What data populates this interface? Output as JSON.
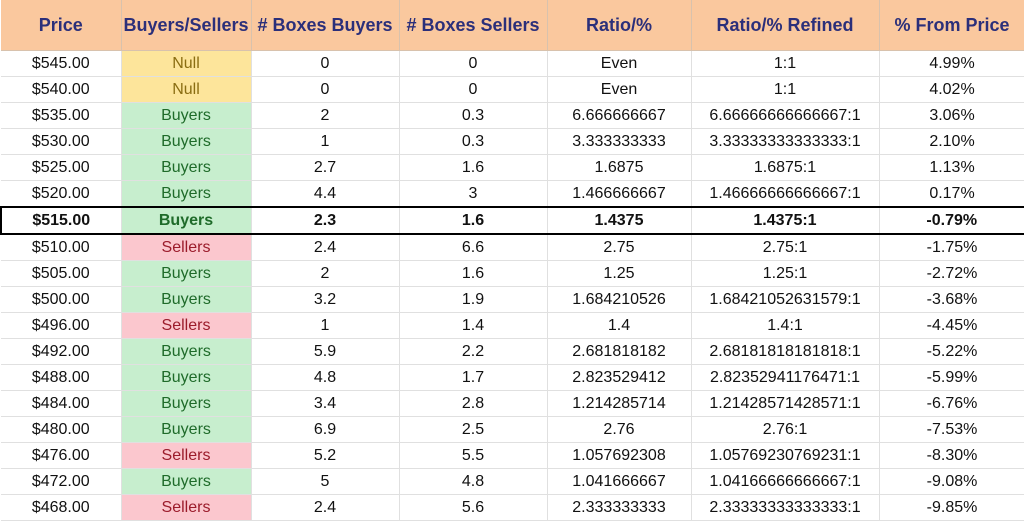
{
  "headers": [
    "Price",
    "Buyers/Sellers",
    "# Boxes Buyers",
    "# Boxes Sellers",
    "Ratio/%",
    "Ratio/% Refined",
    "% From Price"
  ],
  "rows": [
    [
      "$545.00",
      "Null",
      "0",
      "0",
      "Even",
      "1:1",
      "4.99%"
    ],
    [
      "$540.00",
      "Null",
      "0",
      "0",
      "Even",
      "1:1",
      "4.02%"
    ],
    [
      "$535.00",
      "Buyers",
      "2",
      "0.3",
      "6.666666667",
      "6.66666666666667:1",
      "3.06%"
    ],
    [
      "$530.00",
      "Buyers",
      "1",
      "0.3",
      "3.333333333",
      "3.33333333333333:1",
      "2.10%"
    ],
    [
      "$525.00",
      "Buyers",
      "2.7",
      "1.6",
      "1.6875",
      "1.6875:1",
      "1.13%"
    ],
    [
      "$520.00",
      "Buyers",
      "4.4",
      "3",
      "1.466666667",
      "1.46666666666667:1",
      "0.17%"
    ],
    [
      "$515.00",
      "Buyers",
      "2.3",
      "1.6",
      "1.4375",
      "1.4375:1",
      "-0.79%"
    ],
    [
      "$510.00",
      "Sellers",
      "2.4",
      "6.6",
      "2.75",
      "2.75:1",
      "-1.75%"
    ],
    [
      "$505.00",
      "Buyers",
      "2",
      "1.6",
      "1.25",
      "1.25:1",
      "-2.72%"
    ],
    [
      "$500.00",
      "Buyers",
      "3.2",
      "1.9",
      "1.684210526",
      "1.68421052631579:1",
      "-3.68%"
    ],
    [
      "$496.00",
      "Sellers",
      "1",
      "1.4",
      "1.4",
      "1.4:1",
      "-4.45%"
    ],
    [
      "$492.00",
      "Buyers",
      "5.9",
      "2.2",
      "2.681818182",
      "2.68181818181818:1",
      "-5.22%"
    ],
    [
      "$488.00",
      "Buyers",
      "4.8",
      "1.7",
      "2.823529412",
      "2.82352941176471:1",
      "-5.99%"
    ],
    [
      "$484.00",
      "Buyers",
      "3.4",
      "2.8",
      "1.214285714",
      "1.21428571428571:1",
      "-6.76%"
    ],
    [
      "$480.00",
      "Buyers",
      "6.9",
      "2.5",
      "2.76",
      "2.76:1",
      "-7.53%"
    ],
    [
      "$476.00",
      "Sellers",
      "5.2",
      "5.5",
      "1.057692308",
      "1.05769230769231:1",
      "-8.30%"
    ],
    [
      "$472.00",
      "Buyers",
      "5",
      "4.8",
      "1.041666667",
      "1.04166666666667:1",
      "-9.08%"
    ],
    [
      "$468.00",
      "Sellers",
      "2.4",
      "5.6",
      "2.333333333",
      "2.33333333333333:1",
      "-9.85%"
    ]
  ],
  "highlighted_row": "$515.00",
  "colors": {
    "header_bg": "#fac89e",
    "header_text": "#2b2f7a",
    "null_bg": "#fde59b",
    "buyers_bg": "#c7eece",
    "sellers_bg": "#fbc7ce"
  }
}
